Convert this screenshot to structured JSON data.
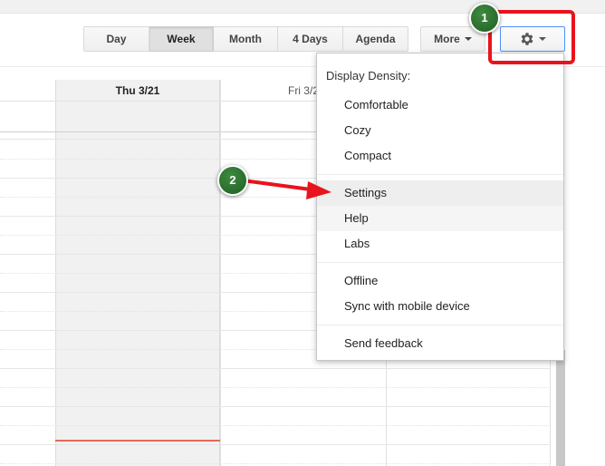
{
  "views": {
    "day": "Day",
    "week": "Week",
    "month": "Month",
    "four_days": "4 Days",
    "agenda": "Agenda",
    "active": "Week"
  },
  "more": {
    "label": "More"
  },
  "settings_button": {
    "icon": "gear-icon",
    "dropdown_icon": "chevron-down-icon"
  },
  "grid": {
    "day_headers": [
      "Thu 3/21",
      "Fri 3/2"
    ]
  },
  "menu": {
    "density_label": "Display Density:",
    "density_options": [
      "Comfortable",
      "Cozy",
      "Compact"
    ],
    "items_group1": [
      "Settings",
      "Help",
      "Labs"
    ],
    "items_group2": [
      "Offline",
      "Sync with mobile device"
    ],
    "items_group3": [
      "Send feedback"
    ]
  },
  "callouts": {
    "step1": "1",
    "step2": "2"
  },
  "colors": {
    "highlight": "#e8141d",
    "badge": "#2e7232",
    "gear_border": "#4d90fe",
    "now_line": "#e8665a"
  }
}
